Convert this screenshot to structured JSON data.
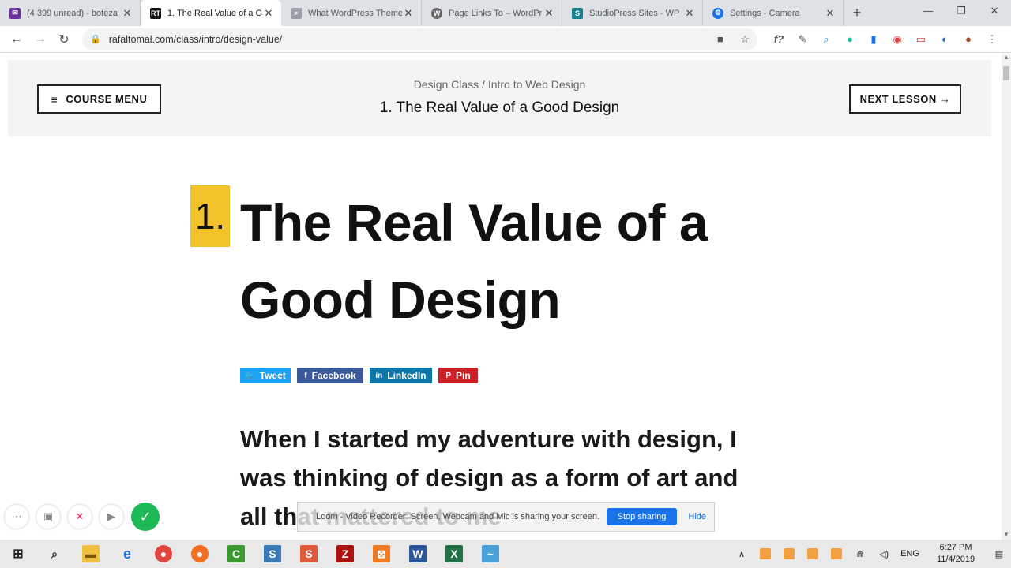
{
  "browser": {
    "tabs": [
      {
        "title": "(4 399 unread) - boteza",
        "fav_color": "#6b2fa0",
        "fav_glyph": "✉"
      },
      {
        "title": "1. The Real Value of a G",
        "fav_color": "#111111",
        "fav_glyph": "RT"
      },
      {
        "title": "What WordPress Theme",
        "fav_color": "#9aa0a6",
        "fav_glyph": "🔍"
      },
      {
        "title": "Page Links To – WordPr",
        "fav_color": "#666666",
        "fav_glyph": "W"
      },
      {
        "title": "StudioPress Sites - WP",
        "fav_color": "#1a7f8c",
        "fav_glyph": "S"
      },
      {
        "title": "Settings - Camera",
        "fav_color": "#1a73e8",
        "fav_glyph": "⚙"
      }
    ],
    "url": "rafaltomal.com/class/intro/design-value/"
  },
  "header": {
    "course_menu": "COURSE MENU",
    "breadcrumb": "Design Class / Intro to Web Design",
    "lesson_title": "1. The Real Value of a Good Design",
    "next_lesson": "NEXT LESSON →"
  },
  "article": {
    "number": "1.",
    "title": "The Real Value of a Good Design",
    "share": {
      "tweet": "Tweet",
      "facebook": "Facebook",
      "linkedin": "LinkedIn",
      "pin": "Pin"
    },
    "intro": "When I started my adventure with design, I was thinking of design as a form of art and all that mattered to me"
  },
  "loom": {
    "message": "Loom - Video Recorder: Screen, Webcam and Mic is sharing your screen.",
    "stop_label": "Stop sharing",
    "hide_label": "Hide"
  },
  "taskbar": {
    "language": "ENG",
    "time": "6:27 PM",
    "date": "11/4/2019"
  },
  "colors": {
    "accent_badge": "#f3c22a",
    "twitter": "#1da1f2",
    "facebook": "#3b5998",
    "linkedin": "#0e76a8",
    "pinterest": "#cb2027"
  }
}
